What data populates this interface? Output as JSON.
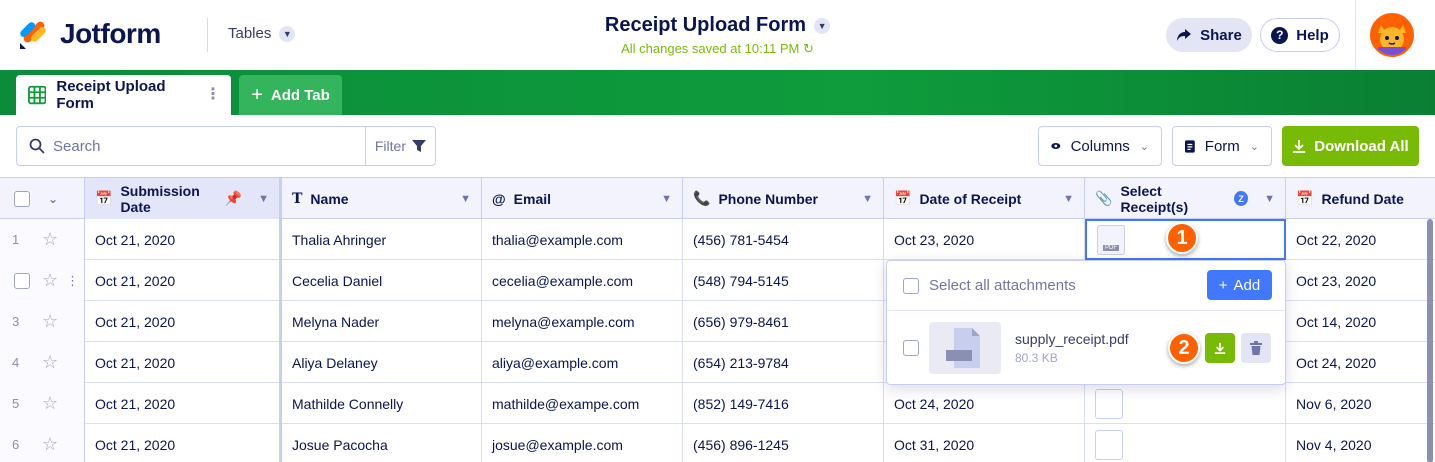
{
  "app": {
    "brand": "Jotform",
    "tables_label": "Tables"
  },
  "form": {
    "title": "Receipt Upload Form",
    "save_status": "All changes saved at 10:11 PM"
  },
  "header": {
    "share_label": "Share",
    "help_label": "Help"
  },
  "tabs": {
    "active_label": "Receipt Upload Form",
    "add_label": "Add Tab"
  },
  "toolbar": {
    "search_placeholder": "Search",
    "filter_label": "Filter",
    "columns_label": "Columns",
    "form_label": "Form",
    "download_label": "Download All"
  },
  "columns": [
    "Submission Date",
    "Name",
    "Email",
    "Phone Number",
    "Date of Receipt",
    "Select Receipt(s)",
    "Refund Date"
  ],
  "rows": [
    {
      "num": "1",
      "submission": "Oct 21, 2020",
      "name": "Thalia Ahringer",
      "email": "thalia@example.com",
      "phone": "(456) 781-5454",
      "receipt_date": "Oct 23, 2020",
      "refund": "Oct 22, 2020"
    },
    {
      "num": "",
      "submission": "Oct 21, 2020",
      "name": "Cecelia Daniel",
      "email": "cecelia@example.com",
      "phone": "(548) 794-5145",
      "receipt_date": "",
      "refund": "Oct 23, 2020"
    },
    {
      "num": "3",
      "submission": "Oct 21, 2020",
      "name": "Melyna Nader",
      "email": "melyna@example.com",
      "phone": "(656) 979-8461",
      "receipt_date": "",
      "refund": "Oct 14, 2020"
    },
    {
      "num": "4",
      "submission": "Oct 21, 2020",
      "name": "Aliya Delaney",
      "email": "aliya@example.com",
      "phone": "(654) 213-9784",
      "receipt_date": "",
      "refund": "Oct 24, 2020"
    },
    {
      "num": "5",
      "submission": "Oct 21, 2020",
      "name": "Mathilde Connelly",
      "email": "mathilde@exampe.com",
      "phone": "(852) 149-7416",
      "receipt_date": "Oct 24, 2020",
      "refund": "Nov 6, 2020"
    },
    {
      "num": "6",
      "submission": "Oct 21, 2020",
      "name": "Josue Pacocha",
      "email": "josue@example.com",
      "phone": "(456) 896-1245",
      "receipt_date": "Oct 31, 2020",
      "refund": "Nov 4, 2020"
    }
  ],
  "popover": {
    "select_all_label": "Select all attachments",
    "add_label": "Add",
    "file_name": "supply_receipt.pdf",
    "file_size": "80.3 KB",
    "pdf_badge": "PDF"
  },
  "markers": [
    "1",
    "2"
  ],
  "colors": {
    "brand_green": "#0e9c3c",
    "accent_orange": "#ff6100",
    "download_green": "#78bb07",
    "add_blue": "#4277ff",
    "navy": "#0a1551"
  }
}
